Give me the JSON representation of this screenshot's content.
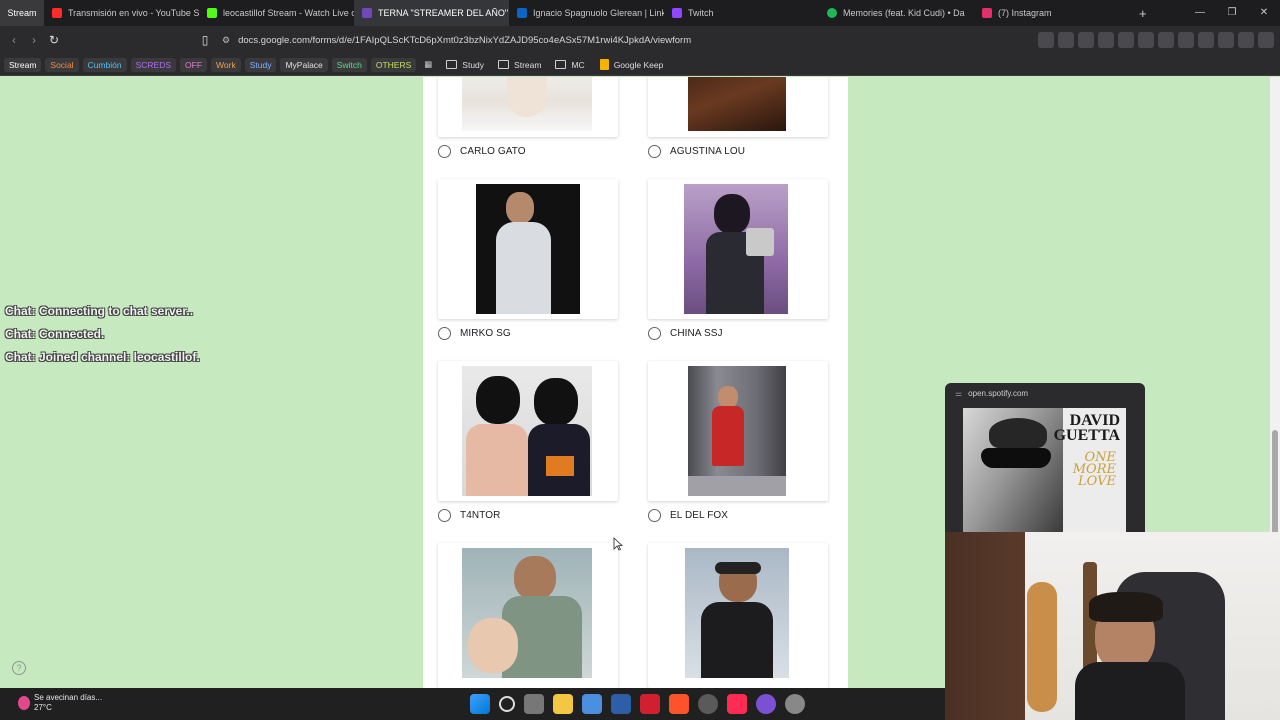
{
  "browser": {
    "tabs": [
      {
        "label": "Stream",
        "icon": "profile-icon",
        "pinned": true
      },
      {
        "label": "Transmisión en vivo - YouTube Stu",
        "icon": "youtube-icon",
        "color": "#ff2a2a"
      },
      {
        "label": "leocastillof Stream - Watch Live on",
        "icon": "kick-icon",
        "color": "#53fc18"
      },
      {
        "label": "TERNA \"STREAMER DEL AÑO\"",
        "icon": "google-forms-icon",
        "color": "#7248b9",
        "active": true
      },
      {
        "label": "Ignacio Spagnuolo Glerean | Linke",
        "icon": "linkedin-icon",
        "color": "#0a66c2"
      },
      {
        "label": "Twitch",
        "icon": "twitch-icon",
        "color": "#9146ff"
      },
      {
        "label": "Memories (feat. Kid Cudi) • Da",
        "icon": "spotify-icon",
        "color": "#1db954"
      },
      {
        "label": "(7) Instagram",
        "icon": "instagram-icon",
        "color": "#e1306c"
      }
    ],
    "new_tab": "+",
    "url": "docs.google.com/forms/d/e/1FAIpQLScKTcD6pXmt0z3bzNixYdZAJD95co4eASx57M1rwi4KJpkdA/viewform",
    "bookmarks": [
      {
        "label": "Stream",
        "color": "#ffffff"
      },
      {
        "label": "Social",
        "color": "#f28b45"
      },
      {
        "label": "Cumbión",
        "color": "#4fc3f7"
      },
      {
        "label": "SCREDS",
        "color": "#b16cf0"
      },
      {
        "label": "OFF",
        "color": "#e57cd8"
      },
      {
        "label": "Work",
        "color": "#f0a04b"
      },
      {
        "label": "Study",
        "color": "#7fb0ff"
      },
      {
        "label": "MyPalace",
        "color": "#e0e0e0"
      },
      {
        "label": "Switch",
        "color": "#5ddc8a"
      },
      {
        "label": "OTHERS",
        "color": "#c0e060"
      }
    ],
    "bookmark_folders": [
      "Study",
      "Stream",
      "MC"
    ],
    "keep_bookmark": "Google Keep"
  },
  "form": {
    "options": [
      {
        "label": "CARLO GATO"
      },
      {
        "label": "AGUSTINA LOU"
      },
      {
        "label": "MIRKO SG"
      },
      {
        "label": "CHINA SSJ"
      },
      {
        "label": "T4NTOR"
      },
      {
        "label": "EL DEL FOX"
      },
      {
        "label": ""
      },
      {
        "label": ""
      }
    ],
    "help": "?"
  },
  "chat": [
    "Chat: Connecting to chat server..",
    "Chat: Connected.",
    "Chat: Joined channel: leocastillof."
  ],
  "pip": {
    "source": "open.spotify.com",
    "album_artist": "DAVID GUETTA",
    "album_title": "ONE MORE LOVE"
  },
  "taskbar": {
    "weather_text": "Se avecinan días...",
    "temperature": "27°C"
  }
}
